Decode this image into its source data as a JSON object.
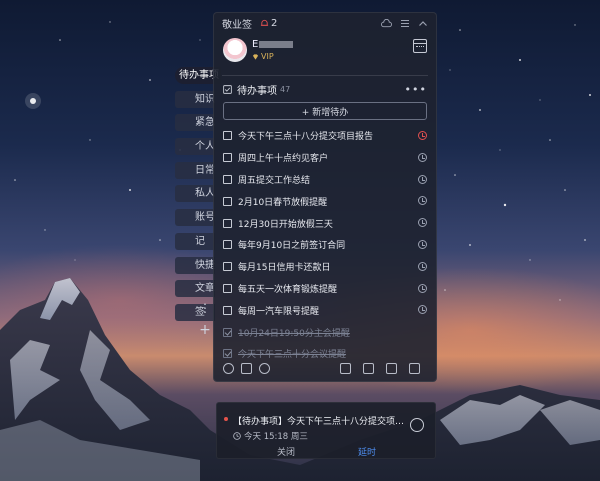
{
  "window": {
    "app_name": "敬业签",
    "notification_count": "2"
  },
  "user": {
    "name": "E",
    "badge": "VIP"
  },
  "tags": [
    {
      "label": "待办事项"
    },
    {
      "label": "知识"
    },
    {
      "label": "紧急"
    },
    {
      "label": "个人"
    },
    {
      "label": "日常"
    },
    {
      "label": "私人"
    },
    {
      "label": "账号"
    },
    {
      "label": "记"
    },
    {
      "label": "快捷"
    },
    {
      "label": "文章"
    },
    {
      "label": "签"
    }
  ],
  "tag_controls": {
    "more": "⋮",
    "add": "+"
  },
  "list": {
    "title": "待办事项",
    "count": "47",
    "more": "•••",
    "new_button": "+ 新增待办"
  },
  "tasks": [
    {
      "text": "今天下午三点十八分提交项目报告",
      "done": false,
      "clock": "red"
    },
    {
      "text": "周四上午十点约见客户",
      "done": false,
      "clock": "gray"
    },
    {
      "text": "周五提交工作总结",
      "done": false,
      "clock": "gray"
    },
    {
      "text": "2月10日春节放假提醒",
      "done": false,
      "clock": "gray"
    },
    {
      "text": "12月30日开始放假三天",
      "done": false,
      "clock": "gray"
    },
    {
      "text": "每年9月10日之前签订合同",
      "done": false,
      "clock": "gray"
    },
    {
      "text": "每月15日信用卡还款日",
      "done": false,
      "clock": "gray"
    },
    {
      "text": "每五天一次体育锻炼提醒",
      "done": false,
      "clock": "gray"
    },
    {
      "text": "每周一汽车限号提醒",
      "done": false,
      "clock": "gray"
    },
    {
      "text": "10月24日19:50分主会提醒",
      "done": true,
      "clock": "none"
    },
    {
      "text": "今天下午三点十分会议提醒",
      "done": true,
      "clock": "none"
    }
  ],
  "reminder": {
    "message": "【待办事项】今天下午三点十八分提交项目报告",
    "time": "今天 15:18 周三",
    "close_label": "关闭",
    "snooze_label": "延时"
  },
  "colors": {
    "accent": "#4e8ef0",
    "alert": "#e05050",
    "vip_gold": "#d9b25a"
  }
}
